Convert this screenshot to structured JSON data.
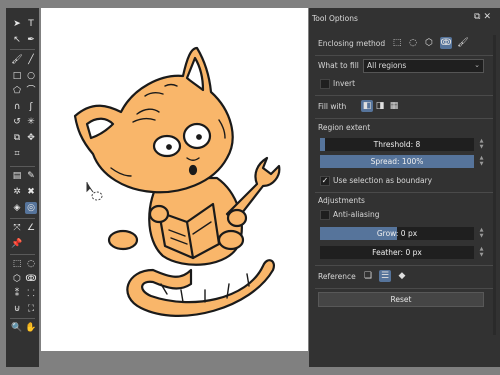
{
  "tool_options": {
    "title": "Tool Options",
    "enclosing_method": {
      "label": "Enclosing method",
      "options": [
        "rectangle-icon",
        "ellipse-icon",
        "polygon-icon",
        "lasso-icon",
        "brush-icon"
      ],
      "selected": "lasso-icon"
    },
    "what_to_fill": {
      "label": "What to fill",
      "value": "All regions"
    },
    "invert": {
      "label": "Invert",
      "checked": false
    },
    "fill_with": {
      "label": "Fill with",
      "options": [
        "foreground-color-icon",
        "background-color-icon",
        "pattern-icon"
      ],
      "selected": "foreground-color-icon"
    },
    "region_extent": {
      "heading": "Region extent",
      "threshold": {
        "label": "Threshold: 8",
        "value": 8,
        "fraction": 0.03
      },
      "spread": {
        "label": "Spread: 100%",
        "value": 100,
        "fraction": 1.0
      },
      "use_selection_as_boundary": {
        "label": "Use selection as boundary",
        "checked": true
      }
    },
    "adjustments": {
      "heading": "Adjustments",
      "anti_aliasing": {
        "label": "Anti-aliasing",
        "checked": false
      },
      "grow": {
        "label": "Grow: 0 px",
        "value": 0,
        "fraction": 0.5
      },
      "feather": {
        "label": "Feather: 0 px",
        "value": 0,
        "fraction": 0.0
      }
    },
    "reference": {
      "label": "Reference",
      "options": [
        "current-layer-icon",
        "all-layers-icon",
        "color-labeled-layers-icon"
      ],
      "selected": "all-layers-icon"
    },
    "reset_label": "Reset"
  },
  "toolbox": {
    "tools": [
      "select-shapes-icon",
      "text-icon",
      "edit-shapes-icon",
      "calligraphy-icon",
      "freehand-brush-icon",
      "line-icon",
      "rectangle-icon",
      "ellipse-icon",
      "polygon-icon",
      "polyline-icon",
      "bezier-curve-icon",
      "freehand-path-icon",
      "dynamic-brush-icon",
      "multibrush-icon",
      "transform-icon",
      "move-icon",
      "crop-icon",
      "gradient-icon",
      "color-picker-icon",
      "smart-patch-icon",
      "colorize-mask-icon",
      "fill-icon",
      "enclose-fill-icon",
      "assistant-icon",
      "measure-icon",
      "reference-images-icon",
      "rectangular-selection-icon",
      "elliptical-selection-icon",
      "polygonal-selection-icon",
      "freehand-selection-icon",
      "contiguous-selection-icon",
      "similar-color-selection-icon",
      "bezier-selection-icon",
      "magnetic-selection-icon",
      "zoom-icon",
      "pan-icon"
    ],
    "active_tool": "enclose-fill-icon"
  },
  "colors": {
    "accent": "#56749b",
    "panel": "#323232",
    "cat_fill": "#f9b66a",
    "canvas_bg": "#808080"
  }
}
